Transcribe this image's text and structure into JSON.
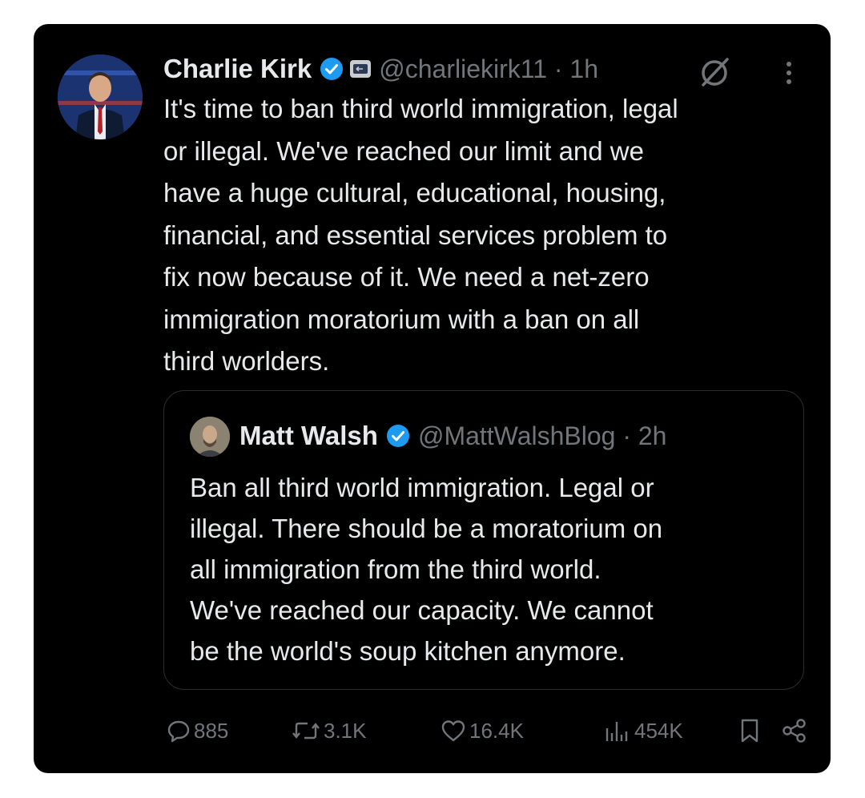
{
  "tweet": {
    "author_name": "Charlie Kirk",
    "handle_time": "@charliekirk11 · 1h",
    "text": "It's time to ban third world immigration, legal\nor illegal. We've reached our limit and we\nhave a huge cultural, educational, housing,\nfinancial, and essential services problem to\nfix now because of it. We need a net-zero\nimmigration moratorium with a ban on all\nthird worlders."
  },
  "quoted_tweet": {
    "author_name": "Matt Walsh",
    "handle_time": "@MattWalshBlog · 2h",
    "text": "Ban all third world immigration. Legal or\nillegal. There should be a moratorium on\nall immigration from the third world.\nWe've reached our capacity. We cannot\nbe the world's soup kitchen anymore."
  },
  "actions": {
    "replies": "885",
    "reposts": "3.1K",
    "likes": "16.4K",
    "views": "454K"
  },
  "colors": {
    "background": "#000000",
    "text_primary": "#e7e9ea",
    "text_secondary": "#71767b",
    "verified_blue": "#1d9bf0"
  },
  "icons": [
    "verified-badge-icon",
    "affiliate-badge-icon",
    "grok-icon",
    "more-icon",
    "reply-icon",
    "repost-icon",
    "like-icon",
    "views-icon",
    "bookmark-icon",
    "share-icon"
  ]
}
